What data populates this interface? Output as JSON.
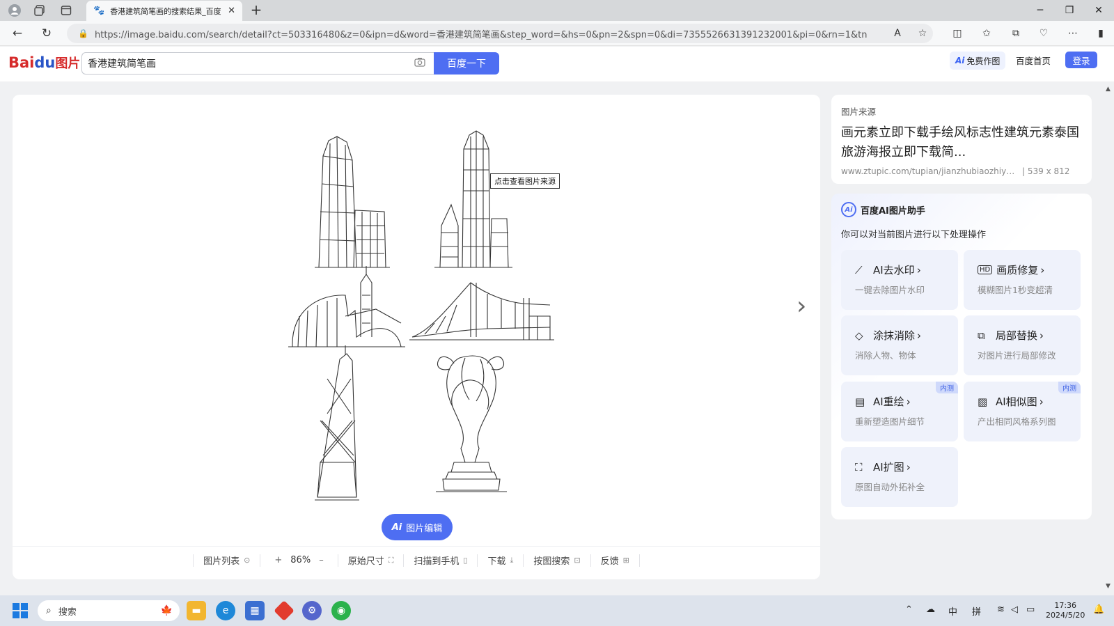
{
  "browser": {
    "tab_title": "香港建筑简笔画的搜索结果_百度",
    "new_tab": "+",
    "url": "https://image.baidu.com/search/detail?ct=503316480&z=0&ipn=d&word=香港建筑简笔画&step_word=&hs=0&pn=2&spn=0&di=7355526631391232001&pi=0&rn=1&tn=baiduimagedetail&..."
  },
  "header": {
    "logo_text_bai": "Bai",
    "logo_text_du": "du",
    "logo_text_cn": "图片",
    "search_value": "香港建筑简笔画",
    "search_button": "百度一下",
    "ai_free": "免费作图",
    "ai_mark": "Ai",
    "home_link": "百度首页",
    "login": "登录"
  },
  "viewer": {
    "tooltip": "点击查看图片来源",
    "edit_button": "图片编辑",
    "toolbar": {
      "list": "图片列表",
      "zoom_in": "+",
      "zoom": "86%",
      "zoom_out": "–",
      "original": "原始尺寸",
      "scan": "扫描到手机",
      "download": "下载",
      "search_by_image": "按图搜索",
      "feedback": "反馈"
    }
  },
  "source": {
    "label": "图片来源",
    "title": "画元素立即下载手绘风标志性建筑元素泰国旅游海报立即下载简...",
    "url": "www.ztupic.com/tupian/jianzhubiaozhiyu...",
    "size": "| 539 x 812"
  },
  "ai_panel": {
    "logo": "Ai",
    "title": "百度AI图片助手",
    "subtitle": "你可以对当前图片进行以下处理操作",
    "tiles": [
      {
        "title": "AI去水印",
        "desc": "一键去除图片水印",
        "badge": ""
      },
      {
        "title": "画质修复",
        "desc": "模糊图片1秒变超清",
        "badge": ""
      },
      {
        "title": "涂抹消除",
        "desc": "消除人物、物体",
        "badge": ""
      },
      {
        "title": "局部替换",
        "desc": "对图片进行局部修改",
        "badge": ""
      },
      {
        "title": "AI重绘",
        "desc": "重新塑造图片细节",
        "badge": "内测"
      },
      {
        "title": "AI相似图",
        "desc": "产出相同风格系列图",
        "badge": "内测"
      },
      {
        "title": "AI扩图",
        "desc": "原图自动外拓补全",
        "badge": ""
      }
    ]
  },
  "taskbar": {
    "search_placeholder": "搜索",
    "ime_lang": "中",
    "ime_mode": "拼",
    "time": "17:36",
    "date": "2024/5/20"
  },
  "colors": {
    "accent": "#4e6ef2",
    "logo_red": "#d62b2b",
    "logo_blue": "#2a55c7"
  }
}
